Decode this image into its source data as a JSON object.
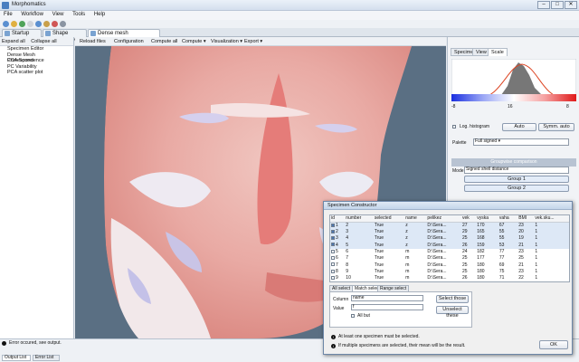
{
  "window": {
    "title": "Morphomatics",
    "minimize": "–",
    "maximize": "□",
    "close": "✕"
  },
  "menu": [
    "File",
    "Workflow",
    "View",
    "Tools",
    "Help"
  ],
  "tabs": [
    {
      "label": "Startup Page"
    },
    {
      "label": "Shape variability"
    },
    {
      "label": "Dense mesh correspondenc..."
    }
  ],
  "sidebar": {
    "expand_all": "Expand all",
    "collapse_all": "Collapse all",
    "items": [
      "Specimen Editor",
      "Dense Mesh Correspondence",
      "PCA Scores",
      "PC Variability",
      "PCA scatter plot"
    ]
  },
  "view_toolbar": {
    "reload": "Reload files",
    "configuration": "Configuration",
    "compute_all": "Compute all",
    "compute": "Compute ▾",
    "visualization": "Visualization ▾",
    "export": "Export ▾"
  },
  "right_panel": {
    "tabs": [
      "Specimens",
      "View",
      "Scale"
    ],
    "active_tab": "Scale",
    "scale_min": "-8",
    "scale_mid": "16",
    "scale_max": "8",
    "log_histogram": "Log. histogram",
    "auto_button": "Auto",
    "symm_auto_button": "Symm. auto",
    "palette_label": "Palette",
    "palette_value": "Full signed",
    "group_header": "Groupwise comparison",
    "mode_label": "Mode",
    "mode_value": "Signed shell distance",
    "group1": "Group 1",
    "group2": "Group 2"
  },
  "statusbar": {
    "message": "Error occured, see output.",
    "output_list": "Output List",
    "error_list": "Error List"
  },
  "dialog": {
    "title": "Specimen Constructor",
    "columns": [
      "id",
      "number",
      "selected",
      "name",
      "pelikez",
      "vek",
      "vyska",
      "vaha",
      "BMI",
      "vek.sku..."
    ],
    "rows": [
      {
        "checked": true,
        "id": "1",
        "number": "2",
        "selected": "True",
        "name": "z",
        "path": "D:\\Sera...",
        "vek": "27",
        "vyska": "170",
        "vaha": "67",
        "bmi": "23",
        "grp": "1"
      },
      {
        "checked": true,
        "id": "2",
        "number": "3",
        "selected": "True",
        "name": "z",
        "path": "D:\\Sera...",
        "vek": "29",
        "vyska": "165",
        "vaha": "55",
        "bmi": "20",
        "grp": "1"
      },
      {
        "checked": true,
        "id": "3",
        "number": "4",
        "selected": "True",
        "name": "z",
        "path": "D:\\Sera...",
        "vek": "25",
        "vyska": "168",
        "vaha": "55",
        "bmi": "19",
        "grp": "1"
      },
      {
        "checked": true,
        "id": "4",
        "number": "5",
        "selected": "True",
        "name": "z",
        "path": "D:\\Sera...",
        "vek": "26",
        "vyska": "159",
        "vaha": "53",
        "bmi": "21",
        "grp": "1"
      },
      {
        "checked": false,
        "id": "5",
        "number": "6",
        "selected": "True",
        "name": "m",
        "path": "D:\\Sera...",
        "vek": "24",
        "vyska": "182",
        "vaha": "77",
        "bmi": "23",
        "grp": "1"
      },
      {
        "checked": false,
        "id": "6",
        "number": "7",
        "selected": "True",
        "name": "m",
        "path": "D:\\Sera...",
        "vek": "25",
        "vyska": "177",
        "vaha": "77",
        "bmi": "25",
        "grp": "1"
      },
      {
        "checked": false,
        "id": "7",
        "number": "8",
        "selected": "True",
        "name": "m",
        "path": "D:\\Sera...",
        "vek": "25",
        "vyska": "180",
        "vaha": "69",
        "bmi": "21",
        "grp": "1"
      },
      {
        "checked": false,
        "id": "8",
        "number": "9",
        "selected": "True",
        "name": "m",
        "path": "D:\\Sera...",
        "vek": "25",
        "vyska": "180",
        "vaha": "75",
        "bmi": "23",
        "grp": "1"
      },
      {
        "checked": false,
        "id": "9",
        "number": "10",
        "selected": "True",
        "name": "m",
        "path": "D:\\Sera...",
        "vek": "26",
        "vyska": "180",
        "vaha": "71",
        "bmi": "22",
        "grp": "1"
      }
    ],
    "tabs": [
      "All select",
      "Match select",
      "Range select"
    ],
    "column_label": "Column",
    "column_value": "name",
    "value_label": "Value",
    "value_value": "f",
    "all_but": "All but",
    "select_those": "Select those",
    "unselect_these": "Unselect these",
    "info1": "At least one specimen must be selected.",
    "info2": "If multiple specimens are selected, their mean will be the result.",
    "ok": "OK"
  }
}
